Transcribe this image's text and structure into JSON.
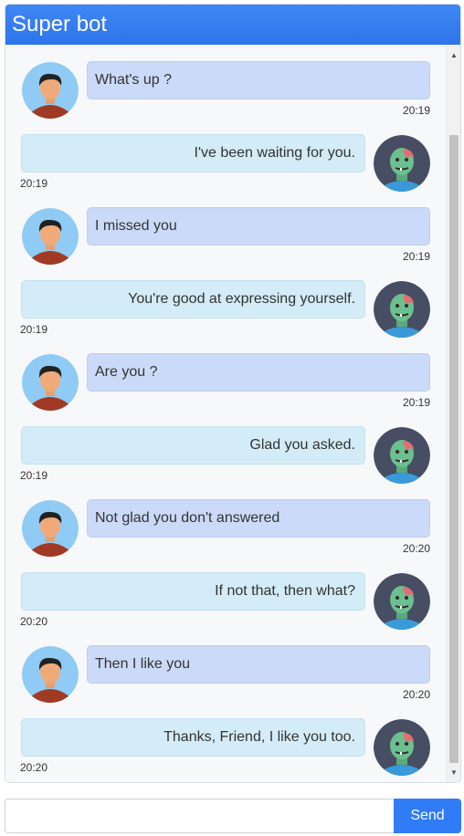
{
  "header": {
    "title": "Super bot"
  },
  "messages": [
    {
      "from": "user",
      "text": "What's up ?",
      "time": "20:19"
    },
    {
      "from": "bot",
      "text": "I've been waiting for you.",
      "time": "20:19"
    },
    {
      "from": "user",
      "text": "I missed you",
      "time": "20:19"
    },
    {
      "from": "bot",
      "text": "You're good at expressing yourself.",
      "time": "20:19"
    },
    {
      "from": "user",
      "text": "Are you ?",
      "time": "20:19"
    },
    {
      "from": "bot",
      "text": "Glad you asked.",
      "time": "20:19"
    },
    {
      "from": "user",
      "text": "Not glad you don't answered",
      "time": "20:20"
    },
    {
      "from": "bot",
      "text": "If not that, then what?",
      "time": "20:20"
    },
    {
      "from": "user",
      "text": "Then I like you",
      "time": "20:20"
    },
    {
      "from": "bot",
      "text": "Thanks, Friend, I like you too.",
      "time": "20:20"
    }
  ],
  "composer": {
    "input_value": "",
    "input_placeholder": "",
    "send_label": "Send"
  },
  "icons": {
    "user_avatar": "person-avatar-icon",
    "bot_avatar": "zombie-avatar-icon"
  },
  "colors": {
    "header": "#3f87f5",
    "user_bubble": "#cbdaf8",
    "bot_bubble": "#d3ecf7",
    "send_button": "#2f7cf6"
  }
}
